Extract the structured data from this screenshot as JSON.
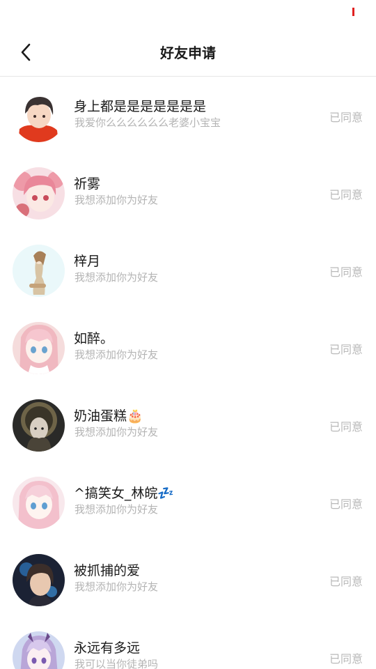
{
  "status_bar": {
    "indicator_color": "#e02020"
  },
  "header": {
    "back_icon": "chevron-left-icon",
    "title": "好友申请"
  },
  "requests": [
    {
      "name": "身上都是是是是是是是",
      "message": "我爱你么么么么么么老婆小宝宝",
      "status": "已同意"
    },
    {
      "name": "祈雾",
      "message": "我想添加你为好友",
      "status": "已同意"
    },
    {
      "name": "梓月",
      "message": "我想添加你为好友",
      "status": "已同意"
    },
    {
      "name": "如醉。",
      "message": "我想添加你为好友",
      "status": "已同意"
    },
    {
      "name": "奶油蛋糕🎂",
      "message": "我想添加你为好友",
      "status": "已同意"
    },
    {
      "name": "^搞笑女_林皖💤",
      "message": "我想添加你为好友",
      "status": "已同意"
    },
    {
      "name": "被抓捕的爱",
      "message": "我想添加你为好友",
      "status": "已同意"
    },
    {
      "name": "永远有多远",
      "message": "我可以当你徒弟吗",
      "status": "已同意"
    }
  ],
  "colors": {
    "divider": "#e6e6e6",
    "secondary_text": "#b4b4b4",
    "status_text": "#b9b9b9"
  }
}
